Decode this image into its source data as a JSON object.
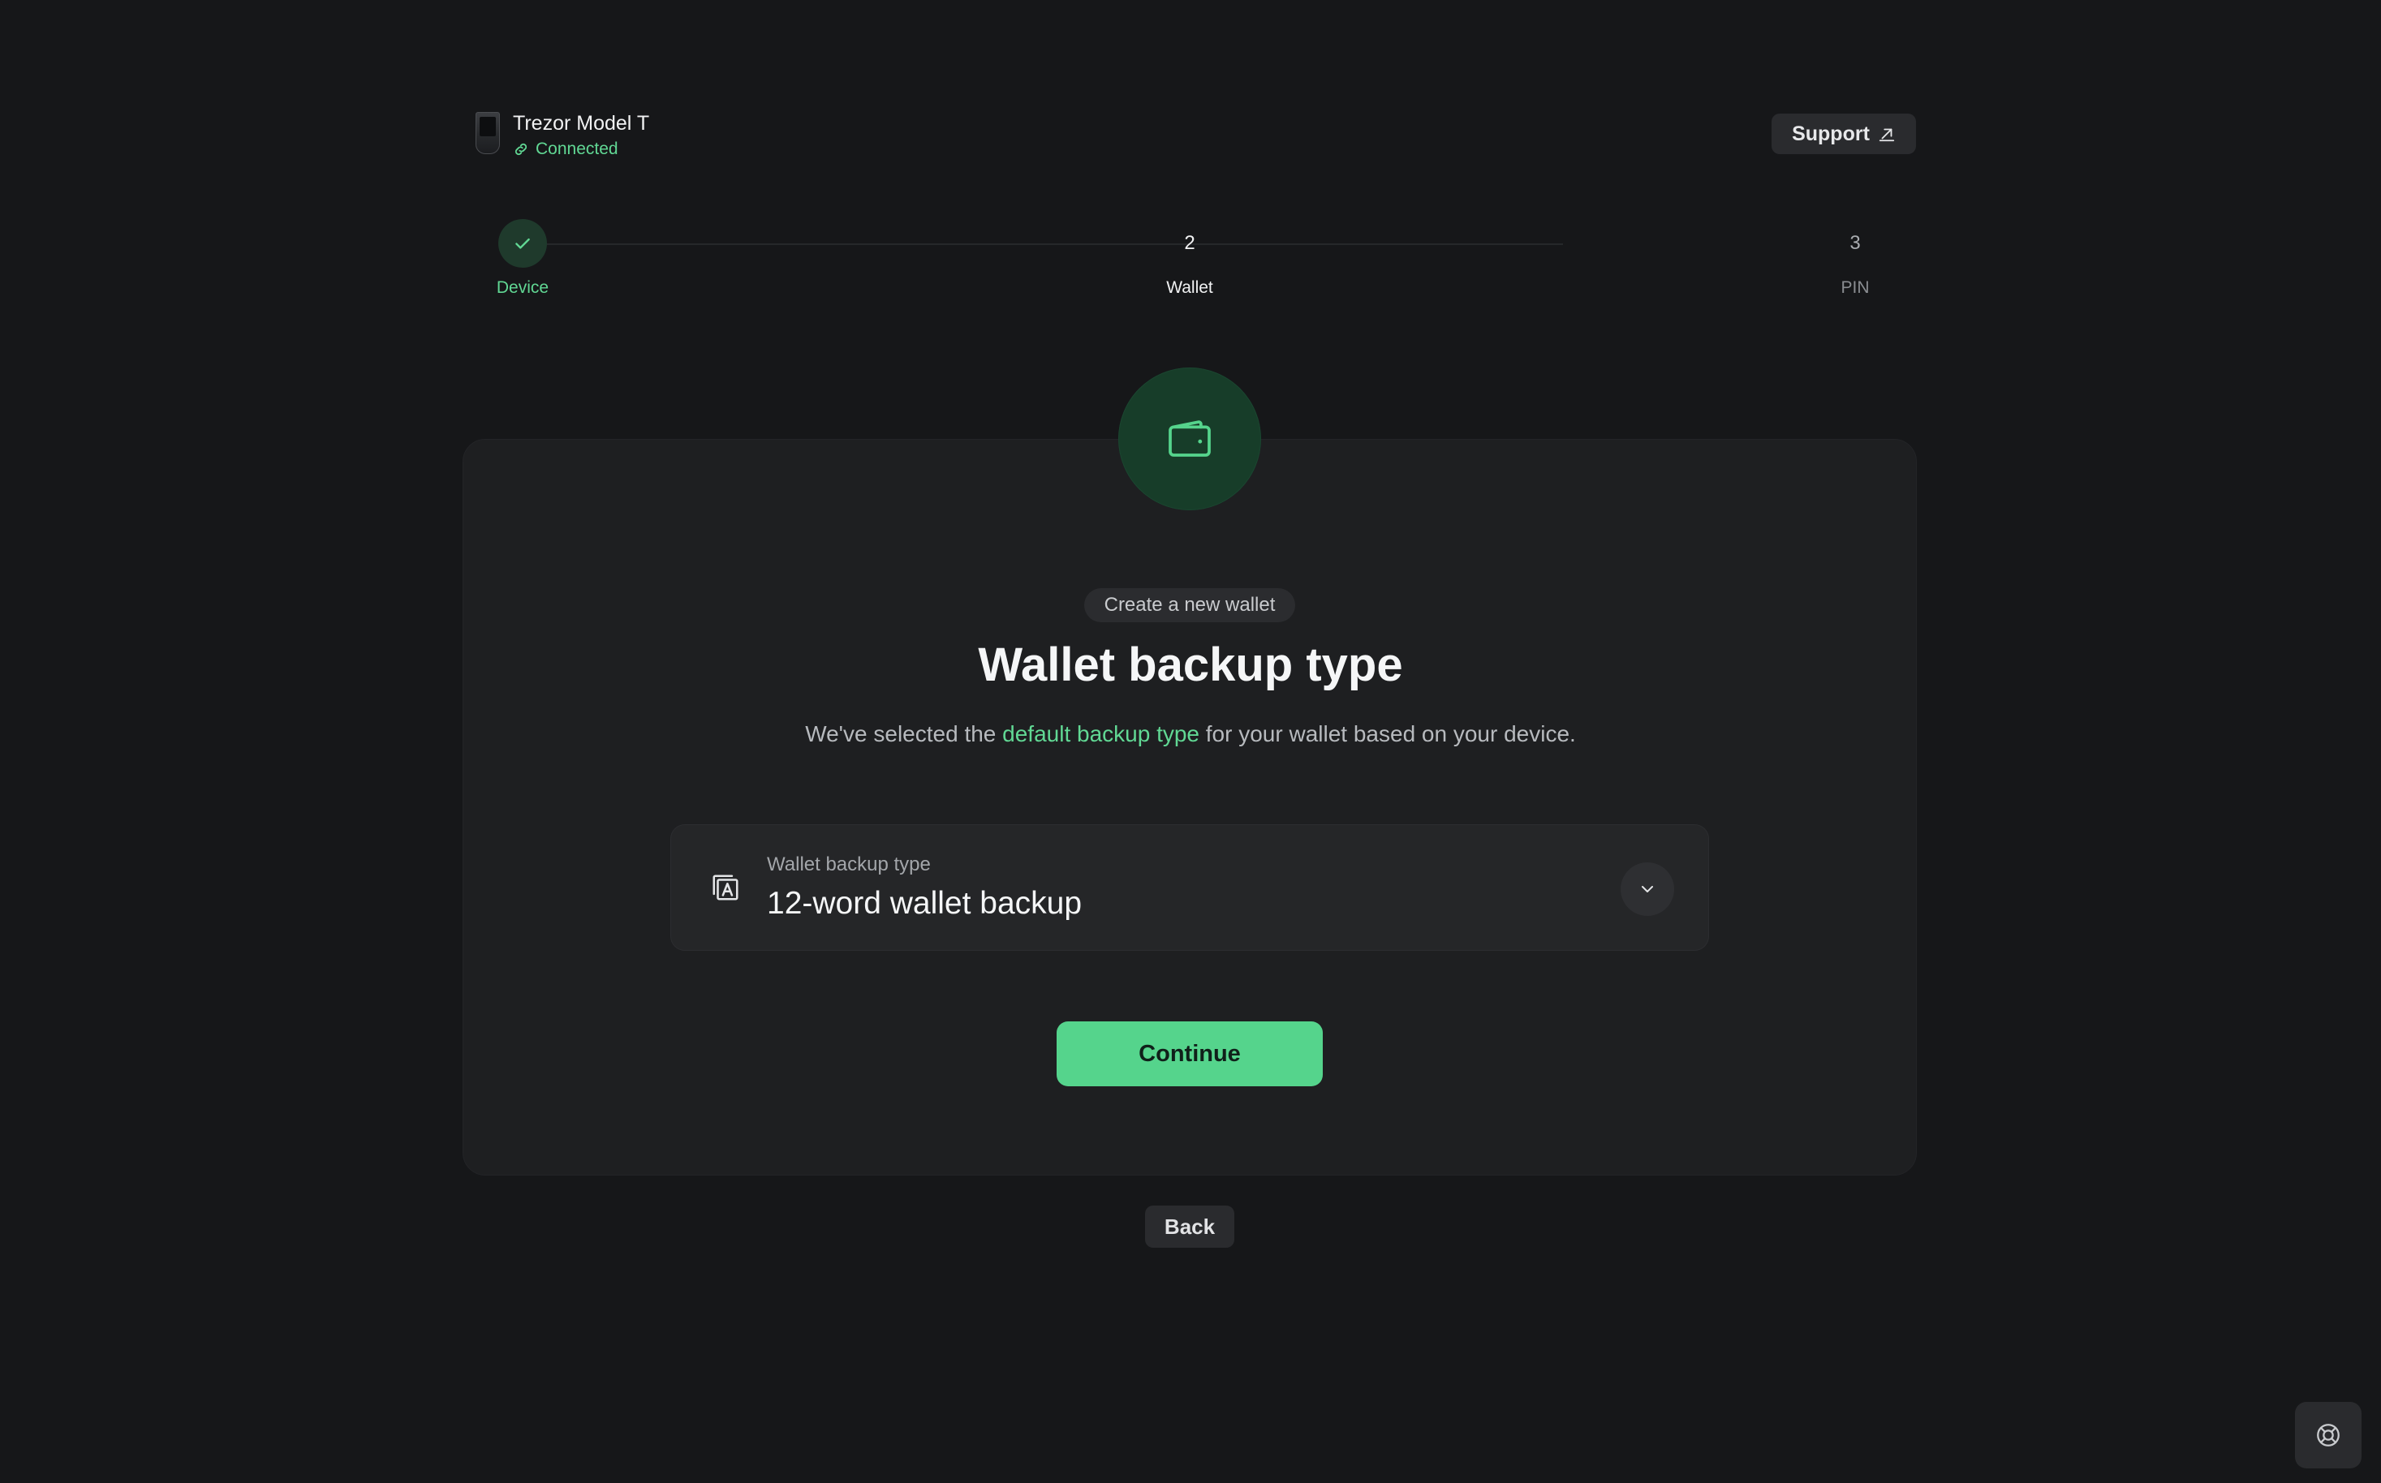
{
  "device": {
    "name": "Trezor Model T",
    "status": "Connected"
  },
  "header": {
    "support_label": "Support"
  },
  "stepper": {
    "steps": [
      {
        "number": "1",
        "label": "Device",
        "state": "done"
      },
      {
        "number": "2",
        "label": "Wallet",
        "state": "active"
      },
      {
        "number": "3",
        "label": "PIN",
        "state": "todo"
      }
    ]
  },
  "main": {
    "eyebrow": "Create a new wallet",
    "title": "Wallet backup type",
    "subtitle_before": "We've selected the ",
    "subtitle_link": "default backup type",
    "subtitle_after": " for your wallet based on your device.",
    "backup_select": {
      "label": "Wallet backup type",
      "value": "12-word wallet backup"
    },
    "continue_label": "Continue",
    "back_label": "Back"
  },
  "icons": {
    "device": "trezor-device-icon",
    "connected": "link-icon",
    "support": "external-link-icon",
    "step_done": "check-icon",
    "hero": "wallet-icon",
    "backup": "backup-card-icon",
    "chevron": "chevron-down-icon",
    "help": "lifebuoy-icon"
  },
  "colors": {
    "accent": "#55d48c",
    "accent_text": "#61d894",
    "background": "#161719",
    "card": "#1e1f21"
  }
}
